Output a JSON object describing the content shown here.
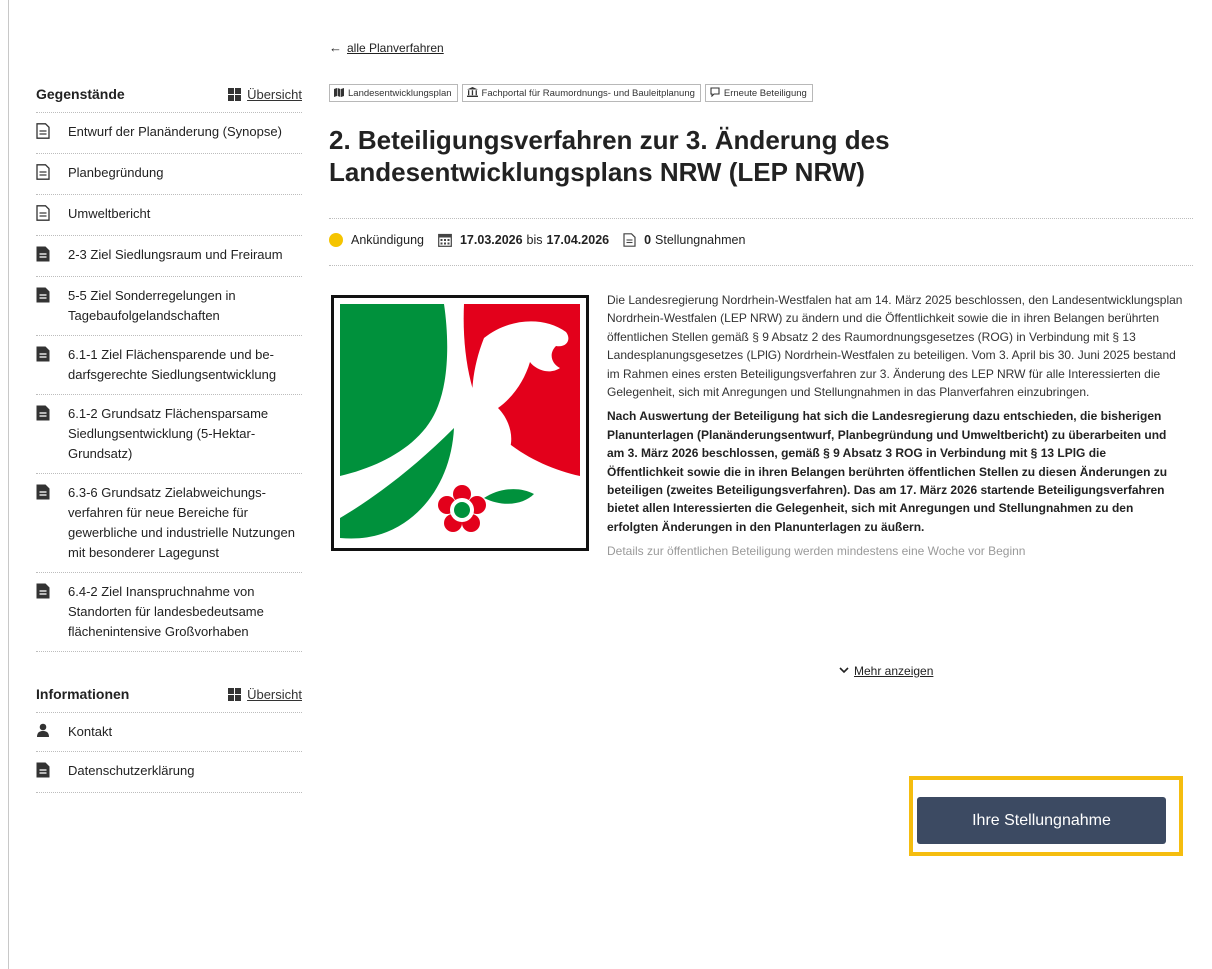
{
  "back_link": {
    "label": "alle Planverfahren"
  },
  "tags": [
    {
      "icon": "map-icon",
      "label": "Landesentwicklungsplan"
    },
    {
      "icon": "institution-icon",
      "label": "Fachportal für Raumordnungs- und Bauleitplanung"
    },
    {
      "icon": "comment-icon",
      "label": "Erneute Beteiligung"
    }
  ],
  "title": "2. Beteiligungsverfahren zur 3. Änderung des Landesentwicklungsplans NRW (LEP NRW)",
  "meta": {
    "status": "Ankündigung",
    "status_color": "#f5c400",
    "date_from": "17.03.2026",
    "date_sep": "bis",
    "date_to": "17.04.2026",
    "statements_count": "0",
    "statements_label": "Stellungnahmen"
  },
  "description": {
    "p1": "Die Landesregierung Nordrhein-Westfalen hat am 14. März 2025 beschlossen, den Landesent­wicklungsplan Nordrhein-Westfalen (LEP NRW) zu ändern und die Öffentlichkeit sowie die in ihren Belangen berührten öffentlichen Stellen gemäß § 9 Absatz 2 des Raumordnungsgesetzes (ROG) in Verbindung mit § 13 Landesplanungsgesetzes (LPlG) Nordrhein-Westfalen zu beteili­gen. Vom 3. April bis 30. Juni 2025 bestand im Rahmen eines ersten Beteiligungsverfahren zur 3. Änderung des LEP NRW für alle Interessierten die Gelegenheit, sich mit Anregungen und Stellungnahmen in das Planverfahren einzubringen.",
    "p2": "Nach Auswertung der Beteiligung hat sich die Landesregierung dazu entschieden, die bisherigen Planunterlagen (Planänderungsentwurf, Planbegründung und Umweltbe­richt) zu überarbeiten und am 3. März 2026 beschlossen, gemäß § 9 Absatz 3 ROG in Ver­bindung mit § 13 LPlG die Öffentlichkeit sowie die in ihren Belangen berührten öffentli­chen Stellen zu diesen Änderungen zu beteiligen (zweites Beteiligungsverfahren). Das am 17. März 2026 startende Beteiligungsverfahren bietet allen Interessierten die Gele­genheit, sich mit Anregungen und Stellungnahmen zu den erfolgten Änderungen in den Planunterlagen zu äußern.",
    "p3": "Details zur öffentlichen Beteiligung werden mindestens eine Woche vor Beginn"
  },
  "more_link": {
    "label": "Mehr anzeigen"
  },
  "cta": {
    "label": "Ihre Stellungnahme",
    "highlight_color": "#f5bd0f",
    "button_color": "#3c4a62"
  },
  "sidebar": {
    "objects": {
      "title": "Gegenstände",
      "overview_label": "Übersicht",
      "items": [
        {
          "icon": "document-outline-icon",
          "label": "Entwurf der Planänderung (Synopse)"
        },
        {
          "icon": "document-outline-icon",
          "label": "Planbegründung"
        },
        {
          "icon": "document-outline-icon",
          "label": "Umweltbericht"
        },
        {
          "icon": "document-filled-icon",
          "label": "2-3 Ziel Siedlungsraum und Freiraum"
        },
        {
          "icon": "document-filled-icon",
          "label": "5-5 Ziel Sonderregelungen in Tagebaufolgelandschaften"
        },
        {
          "icon": "document-filled-icon",
          "label": "6.1-1 Ziel Flächensparende und be­darfsgerechte Siedlungsentwicklung"
        },
        {
          "icon": "document-filled-icon",
          "label": "6.1-2 Grundsatz Flächensparsame Siedlungsentwicklung (5-Hektar-Grundsatz)"
        },
        {
          "icon": "document-filled-icon",
          "label": "6.3-6 Grundsatz Zielabweichungs­verfahren für neue Bereiche für gewerbliche und industrielle Nut­zungen mit besonderer Lagegunst"
        },
        {
          "icon": "document-filled-icon",
          "label": "6.4-2 Ziel Inanspruchnahme von Standorten für landesbedeutsame flächenintensive Großvorhaben"
        }
      ]
    },
    "info": {
      "title": "Informationen",
      "overview_label": "Übersicht",
      "items": [
        {
          "icon": "person-icon",
          "label": "Kontakt"
        },
        {
          "icon": "document-filled-icon",
          "label": "Datenschutzerklärung"
        }
      ]
    }
  }
}
